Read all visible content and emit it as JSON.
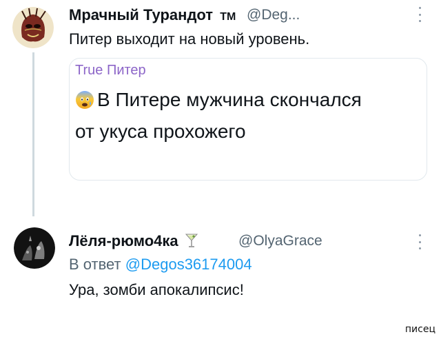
{
  "tweet1": {
    "name": "Мрачный Турандот",
    "name_badge": "ТМ",
    "handle": "@Deg...",
    "text": "Питер выходит на новый уровень.",
    "avatar_icon": "mask-avatar-icon"
  },
  "quote": {
    "title": "True Питер",
    "line1": "В Питере мужчина скончался",
    "line2": "от укуса прохожего",
    "emoji_icon": "anxious-face-emoji-icon"
  },
  "tweet2": {
    "name": "Лёля-рюмо4ка",
    "name_emoji_icon": "cocktail-glass-icon",
    "handle": "@OlyaGrace",
    "reply_prefix": "В ответ",
    "reply_handle": "@Degos36174004",
    "text": "Ура, зомби апокалипсис!",
    "avatar_icon": "dark-photo-avatar-icon"
  },
  "watermark": "писец",
  "colors": {
    "link": "#1d9bf0",
    "quote_title": "#8c65c8",
    "secondary_text": "#536471",
    "thread_line": "#cfd9de"
  }
}
